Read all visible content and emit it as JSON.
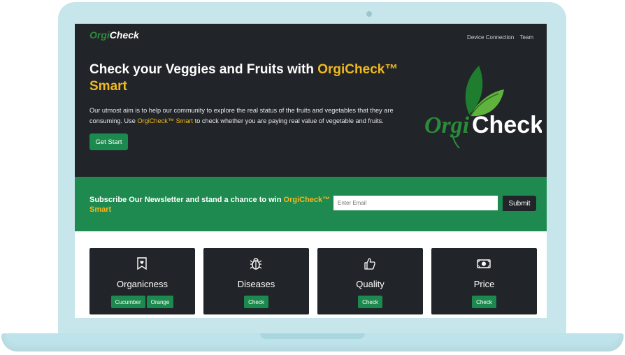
{
  "brand": {
    "orgi": "Orgi",
    "check": "Check"
  },
  "nav": {
    "items": [
      "Device Connection",
      "Team"
    ]
  },
  "hero": {
    "headline_pre": "Check your Veggies and Fruits with ",
    "headline_brand": "OrgiCheck™ Smart",
    "desc_pre": "Our utmost aim is to help our community to explore the real status of the fruits and vegetables that they are consuming. Use ",
    "desc_brand": "OrgiCheck™ Smart",
    "desc_post": " to check whether you are paying real value of vegetable and fruits.",
    "cta": "Get Start"
  },
  "big_logo": {
    "orgi": "Orgi",
    "check": "Check"
  },
  "newsletter": {
    "text_pre": "Subscribe Our Newsletter and stand a chance to win ",
    "text_brand": "OrgiCheck™ Smart",
    "placeholder": "Enter Email",
    "submit": "Submit"
  },
  "features": [
    {
      "title": "Organicness",
      "icon": "bookmark-heart-icon",
      "buttons": [
        "Cucumber",
        "Orange"
      ]
    },
    {
      "title": "Diseases",
      "icon": "bug-icon",
      "buttons": [
        "Check"
      ]
    },
    {
      "title": "Quality",
      "icon": "thumbs-up-icon",
      "buttons": [
        "Check"
      ]
    },
    {
      "title": "Price",
      "icon": "cash-icon",
      "buttons": [
        "Check"
      ]
    }
  ],
  "colors": {
    "dark": "#212428",
    "green": "#1f8a4f",
    "accent": "#f0b922"
  }
}
